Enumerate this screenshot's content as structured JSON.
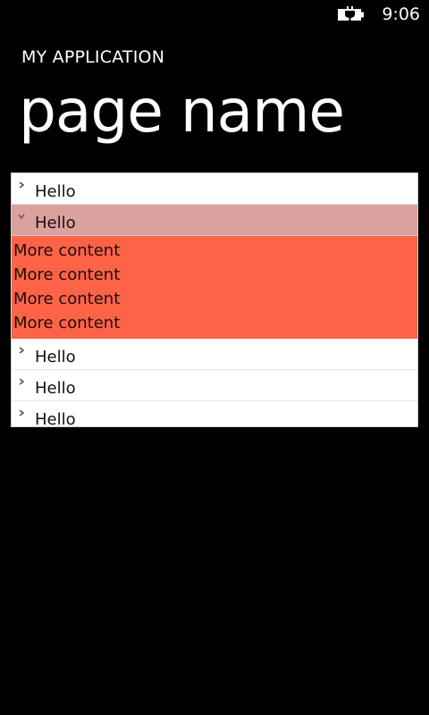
{
  "status_bar": {
    "time": "9:06",
    "battery_icon": "battery-charging-icon"
  },
  "header": {
    "app_title": "MY APPLICATION",
    "page_title": "page name"
  },
  "list": {
    "items": [
      {
        "label": "Hello",
        "expanded": false,
        "chevron": "chevron-right-icon"
      },
      {
        "label": "Hello",
        "expanded": true,
        "chevron": "chevron-down-icon",
        "content": [
          "More content",
          "More content",
          "More content",
          "More content"
        ]
      },
      {
        "label": "Hello",
        "expanded": false,
        "chevron": "chevron-right-icon"
      },
      {
        "label": "Hello",
        "expanded": false,
        "chevron": "chevron-right-icon"
      },
      {
        "label": "Hello",
        "expanded": false,
        "chevron": "chevron-right-icon"
      }
    ]
  },
  "colors": {
    "background": "#000000",
    "list_background": "#ffffff",
    "expanded_header": "#dba19e",
    "expanded_content": "#ff6347"
  }
}
